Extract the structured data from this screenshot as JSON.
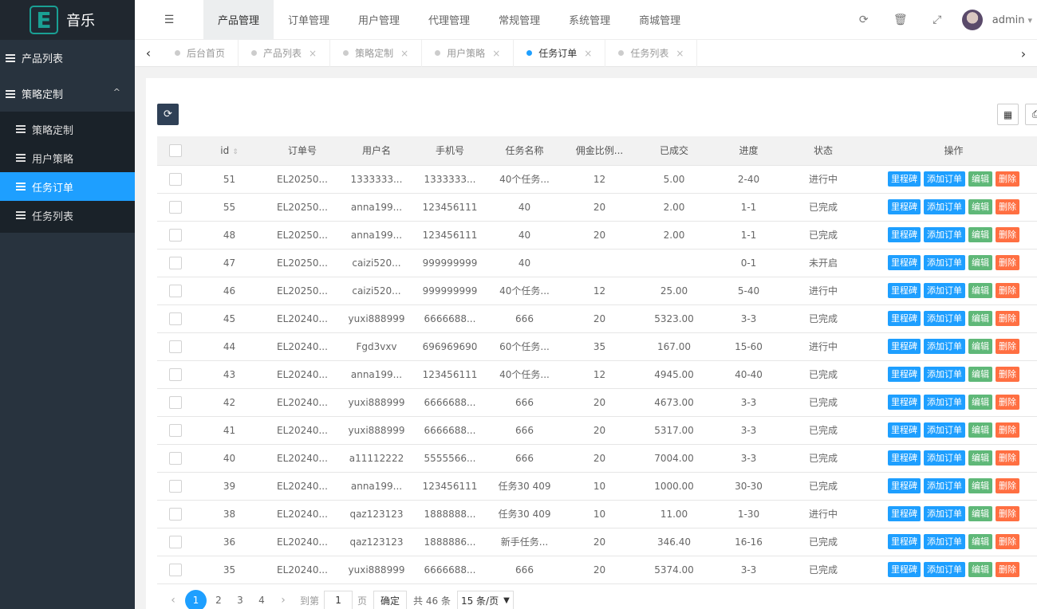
{
  "logo": {
    "letter": "E",
    "text": "音乐"
  },
  "sidebar": {
    "product_list": "产品列表",
    "strategy": "策略定制",
    "chevron": "^",
    "sub_items": [
      {
        "label": "策略定制"
      },
      {
        "label": "用户策略"
      },
      {
        "label": "任务订单"
      },
      {
        "label": "任务列表"
      }
    ]
  },
  "header": {
    "fold_icon": "☰",
    "nav": [
      "产品管理",
      "订单管理",
      "用户管理",
      "代理管理",
      "常规管理",
      "系统管理",
      "商城管理"
    ],
    "user": "admin",
    "dropdown_caret": "▾"
  },
  "tabs": {
    "items": [
      {
        "label": "后台首页",
        "closable": false
      },
      {
        "label": "产品列表",
        "closable": true
      },
      {
        "label": "策略定制",
        "closable": true
      },
      {
        "label": "用户策略",
        "closable": true
      },
      {
        "label": "任务订单",
        "closable": true
      },
      {
        "label": "任务列表",
        "closable": true
      }
    ],
    "close": "×",
    "prev": "‹",
    "next": "›"
  },
  "table": {
    "headers": [
      "id",
      "订单号",
      "用户名",
      "手机号",
      "任务名称",
      "佣金比例...",
      "已成交",
      "进度",
      "状态",
      "操作"
    ],
    "actions": [
      "里程碑",
      "添加订单",
      "编辑",
      "删除"
    ],
    "rows": [
      [
        "51",
        "EL20250...",
        "1333333...",
        "1333333...",
        "40个任务...",
        "12",
        "5.00",
        "2-40",
        "进行中"
      ],
      [
        "55",
        "EL20250...",
        "anna199...",
        "123456111",
        "40",
        "20",
        "2.00",
        "1-1",
        "已完成"
      ],
      [
        "48",
        "EL20250...",
        "anna199...",
        "123456111",
        "40",
        "20",
        "2.00",
        "1-1",
        "已完成"
      ],
      [
        "47",
        "EL20250...",
        "caizi520...",
        "999999999",
        "40",
        "",
        "",
        "0-1",
        "未开启"
      ],
      [
        "46",
        "EL20250...",
        "caizi520...",
        "999999999",
        "40个任务...",
        "12",
        "25.00",
        "5-40",
        "进行中"
      ],
      [
        "45",
        "EL20240...",
        "yuxi888999",
        "6666688...",
        "666",
        "20",
        "5323.00",
        "3-3",
        "已完成"
      ],
      [
        "44",
        "EL20240...",
        "Fgd3vxv",
        "696969690",
        "60个任务...",
        "35",
        "167.00",
        "15-60",
        "进行中"
      ],
      [
        "43",
        "EL20240...",
        "anna199...",
        "123456111",
        "40个任务...",
        "12",
        "4945.00",
        "40-40",
        "已完成"
      ],
      [
        "42",
        "EL20240...",
        "yuxi888999",
        "6666688...",
        "666",
        "20",
        "4673.00",
        "3-3",
        "已完成"
      ],
      [
        "41",
        "EL20240...",
        "yuxi888999",
        "6666688...",
        "666",
        "20",
        "5317.00",
        "3-3",
        "已完成"
      ],
      [
        "40",
        "EL20240...",
        "a11112222",
        "5555566...",
        "666",
        "20",
        "7004.00",
        "3-3",
        "已完成"
      ],
      [
        "39",
        "EL20240...",
        "anna199...",
        "123456111",
        "任务30 409",
        "10",
        "1000.00",
        "30-30",
        "已完成"
      ],
      [
        "38",
        "EL20240...",
        "qaz123123",
        "1888888...",
        "任务30 409",
        "10",
        "11.00",
        "1-30",
        "进行中"
      ],
      [
        "36",
        "EL20240...",
        "qaz123123",
        "1888886...",
        "新手任务...",
        "20",
        "346.40",
        "16-16",
        "已完成"
      ],
      [
        "35",
        "EL20240...",
        "yuxi888999",
        "6666688...",
        "666",
        "20",
        "5374.00",
        "3-3",
        "已完成"
      ]
    ]
  },
  "pager": {
    "pages": [
      "1",
      "2",
      "3",
      "4"
    ],
    "prev": "‹",
    "next": "›",
    "goto_label": "到第",
    "goto_value": "1",
    "page_unit": "页",
    "confirm": "确定",
    "total": "共 46 条",
    "per_page": "15 条/页"
  }
}
